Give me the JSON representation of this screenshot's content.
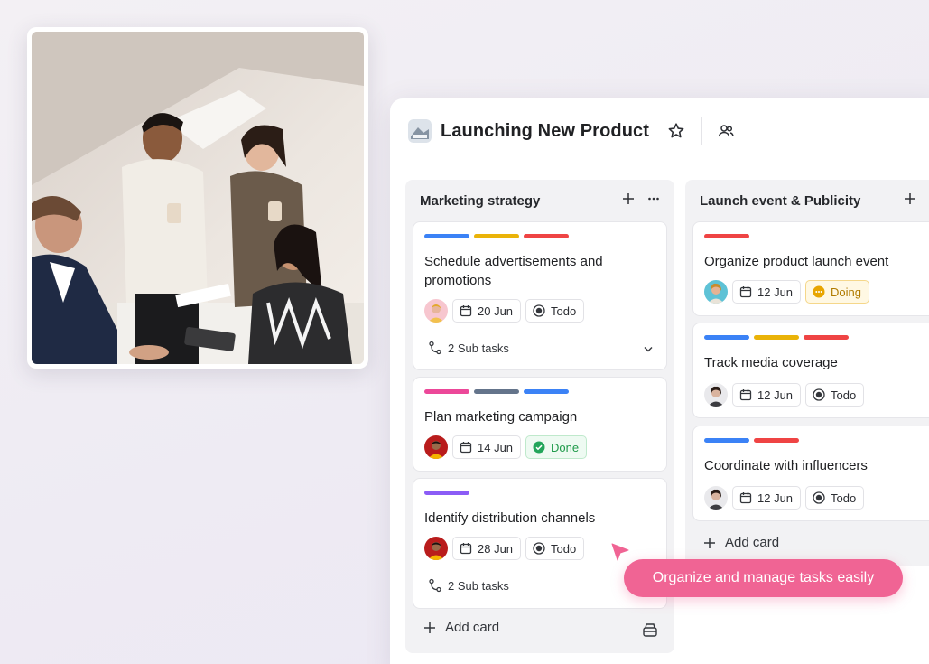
{
  "board": {
    "title": "Launching New Product",
    "icons": {
      "project": "project-thumbnail-icon",
      "star": "star-icon",
      "members": "members-icon"
    }
  },
  "columns": [
    {
      "title": "Marketing strategy",
      "cards": [
        {
          "title": "Schedule advertisements and promotions",
          "tags": [
            "#3b82f6",
            "#eab308",
            "#ef4444"
          ],
          "date": "20 Jun",
          "status": "Todo",
          "subtasks": "2 Sub tasks"
        },
        {
          "title": "Plan marketing campaign",
          "tags": [
            "#ec4899",
            "#64748b",
            "#3b82f6"
          ],
          "date": "14 Jun",
          "status": "Done"
        },
        {
          "title": "Identify distribution channels",
          "tags": [
            "#8b5cf6"
          ],
          "date": "28 Jun",
          "status": "Todo",
          "subtasks": "2 Sub tasks"
        }
      ],
      "add_card": "Add card"
    },
    {
      "title": "Launch event & Publicity",
      "cards": [
        {
          "title": "Organize product launch event",
          "tags": [
            "#ef4444"
          ],
          "date": "12 Jun",
          "status": "Doing"
        },
        {
          "title": "Track media coverage",
          "tags": [
            "#3b82f6",
            "#eab308",
            "#ef4444"
          ],
          "date": "12 Jun",
          "status": "Todo"
        },
        {
          "title": "Coordinate with influencers",
          "tags": [
            "#3b82f6",
            "#ef4444"
          ],
          "date": "12 Jun",
          "status": "Todo"
        }
      ],
      "add_card": "Add card"
    }
  ],
  "toast": {
    "text": "Organize and manage tasks easily"
  },
  "colors": {
    "accent_pink": "#f06494",
    "done_green": "#1f9a4a",
    "doing_amber": "#b07b00"
  }
}
